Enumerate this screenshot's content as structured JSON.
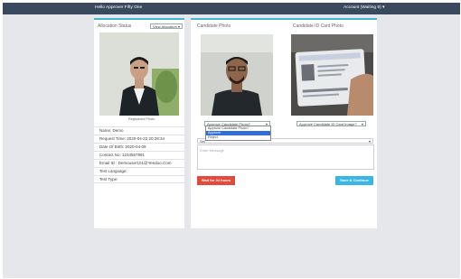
{
  "header": {
    "greeting": "Hello Approver Fifty One",
    "account": "Account (Waiting 9) ▾"
  },
  "allocation": {
    "title": "Allocation Status",
    "select_value": "View Allocation",
    "photo_caption": "Registered Photo",
    "details": [
      "Name: Demo",
      "Request Time: 2020-04-22 20:28:34",
      "Date Of Birth: 2020-04-09",
      "Contact No: 1234567891",
      "Email ID : Demouser101@Yeedoo.Com",
      "Test Language:",
      "Test Type:"
    ]
  },
  "candidate_photo": {
    "title": "Candidate Photo",
    "select_value": "Approve Candidate Photo?",
    "options": [
      "Approve Candidate Photo?",
      "Approve",
      "Reject"
    ],
    "highlighted_index": 1
  },
  "candidate_id": {
    "title": "Candidate ID Card Photo",
    "select_value": "Approve Candidate ID Card Image?"
  },
  "feedback": {
    "select_prefix": "Sel",
    "message_placeholder": "Enter Message"
  },
  "buttons": {
    "wait": "Wait for 24 hours",
    "save": "Save & Continue"
  },
  "colors": {
    "topbar": "#3a4a5e",
    "accent": "#3fb8d8",
    "wait_button": "#e24a3b",
    "save_button": "#3ab6e6"
  }
}
